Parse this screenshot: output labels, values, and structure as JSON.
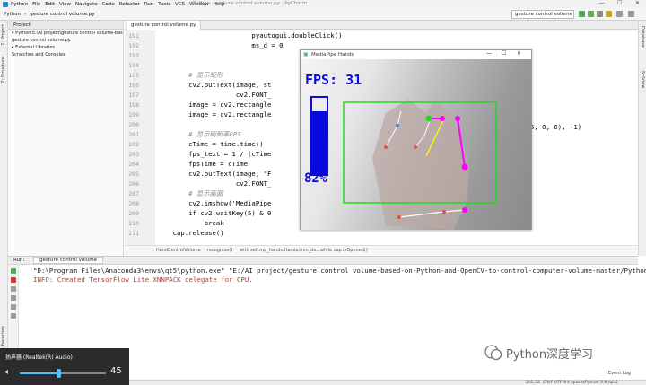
{
  "menu": {
    "app": "Python",
    "items": [
      "File",
      "Edit",
      "View",
      "Navigate",
      "Code",
      "Refactor",
      "Run",
      "Tools",
      "VCS",
      "Window",
      "Help"
    ],
    "title": "Python - gesture control volume.py - PyCharm",
    "min": "—",
    "max": "☐",
    "close": "✕"
  },
  "nav": {
    "crumb1": "Python",
    "crumb2": "gesture control volume.py",
    "run_config": "gesture control volume"
  },
  "left_tabs": {
    "project": "1: Project",
    "structure": "7: Structure",
    "favorites": "2: Favorites"
  },
  "right_tabs": {
    "database": "Database",
    "scview": "SciView"
  },
  "project": {
    "header": "Project",
    "tree": [
      "▾ Python  E:\\AI project\\gesture control volume-bas",
      "      gesture control volume.py",
      "▸ External Libraries",
      "   Scratches and Consoles"
    ]
  },
  "editor": {
    "tab": "gesture control volume.py",
    "lines": [
      {
        "no": "191",
        "text": "                        pyautogui.doubleClick()",
        "cls": ""
      },
      {
        "no": "192",
        "text": "                        ms_d = 0",
        "cls": ""
      },
      {
        "no": "193",
        "text": "",
        "cls": ""
      },
      {
        "no": "194",
        "text": "",
        "cls": ""
      },
      {
        "no": "195",
        "text": "        # 显示矩形",
        "cls": "cmt"
      },
      {
        "no": "196",
        "text": "        cv2.putText(image, st",
        "cls": ""
      },
      {
        "no": "197",
        "text": "                    cv2.FONT_",
        "cls": ""
      },
      {
        "no": "198",
        "text": "        image = cv2.rectangle",
        "cls": ""
      },
      {
        "no": "199",
        "text": "        image = cv2.rectangle",
        "cls": ""
      },
      {
        "no": "200",
        "text": "",
        "cls": ""
      },
      {
        "no": "201",
        "text": "        # 显示刷新率FPS",
        "cls": "cmt"
      },
      {
        "no": "202",
        "text": "        cTime = time.time()",
        "cls": ""
      },
      {
        "no": "203",
        "text": "        fps_text = 1 / (cTime",
        "cls": ""
      },
      {
        "no": "204",
        "text": "        fpsTime = cTime",
        "cls": ""
      },
      {
        "no": "205",
        "text": "        cv2.putText(image, \"F",
        "cls": ""
      },
      {
        "no": "206",
        "text": "                    cv2.FONT_",
        "cls": ""
      },
      {
        "no": "207",
        "text": "        # 显示画面",
        "cls": "cmt"
      },
      {
        "no": "208",
        "text": "        cv2.imshow('MediaPipe",
        "cls": ""
      },
      {
        "no": "209",
        "text": "        if cv2.waitKey(5) & 0",
        "cls": ""
      },
      {
        "no": "210",
        "text": "            break",
        "cls": ""
      },
      {
        "no": "211",
        "text": "    cap.release()",
        "cls": ""
      }
    ],
    "fragment_right": "5, 0, 0), -1)"
  },
  "breadcrumb": [
    "HandControlVolume",
    "recognize()",
    "with self.mp_hands.Hands(min_de...",
    "while cap.isOpened()"
  ],
  "mediapipe": {
    "title": "MediaPipe Hands",
    "fps_text": "FPS: 31",
    "volume_fraction": 0.82,
    "volume_text": "82%",
    "colors": {
      "hud": "#0a0adc",
      "box": "#23d923",
      "joint": "#ff00ff"
    }
  },
  "run": {
    "tab": "Run:",
    "config": "gesture control volume",
    "cmd": "\"D:\\Program Files\\Anaconda3\\envs\\qt5\\python.exe\" \"E:/AI project/gesture control volume-based-on-Python-and-OpenCV-to-control-computer-volume-master/Python",
    "info": "INFO: Created TensorFlow Lite XNNPACK delegate for CPU."
  },
  "status": {
    "pos": "205:52",
    "crlf": "CRLF",
    "enc": "UTF-8",
    "spaces": "4 spaces",
    "interp": "Python 3.8 (qt5)",
    "evlog": "Event Log"
  },
  "volume_flyout": {
    "device": "扬声器 (Realtek(R) Audio)",
    "level": 45,
    "level_text": "45"
  },
  "watermark": {
    "text": "Python深度学习"
  }
}
